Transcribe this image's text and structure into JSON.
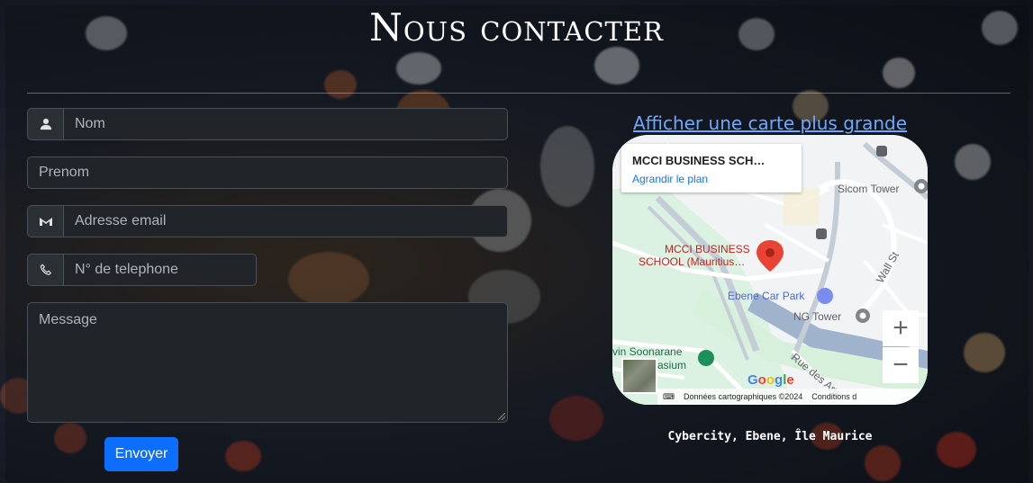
{
  "page": {
    "title": "Nous contacter"
  },
  "form": {
    "nom_placeholder": "Nom",
    "prenom_placeholder": "Prenom",
    "email_placeholder": "Adresse email",
    "phone_placeholder": "N° de telephone",
    "message_placeholder": "Message",
    "submit_label": "Envoyer"
  },
  "map": {
    "link_label": "Afficher une carte plus grande",
    "place_name": "MCCI BUSINESS SCH…",
    "enlarge_label": "Agrandir le plan",
    "pin_label_line1": "MCCI BUSINESS",
    "pin_label_line2": "SCHOOL (Mauritius…",
    "labels": {
      "sicom": "Sicom Tower",
      "carpark": "Ebene Car Park",
      "ng": "NG Tower",
      "wall": "Wall St",
      "arts": "Rue des Arts",
      "gym1": "vin Soonarane",
      "gym2": "asium"
    },
    "google": "Google",
    "attribution": "Données cartographiques ©2024",
    "terms": "Conditions d",
    "zoom_in": "+",
    "zoom_out": "−"
  },
  "address": "Cybercity, Ebene, Île Maurice",
  "colors": {
    "primary": "#0d6efd",
    "link": "#6ea8fe",
    "input_bg": "#212529",
    "pin": "#ea4335"
  }
}
